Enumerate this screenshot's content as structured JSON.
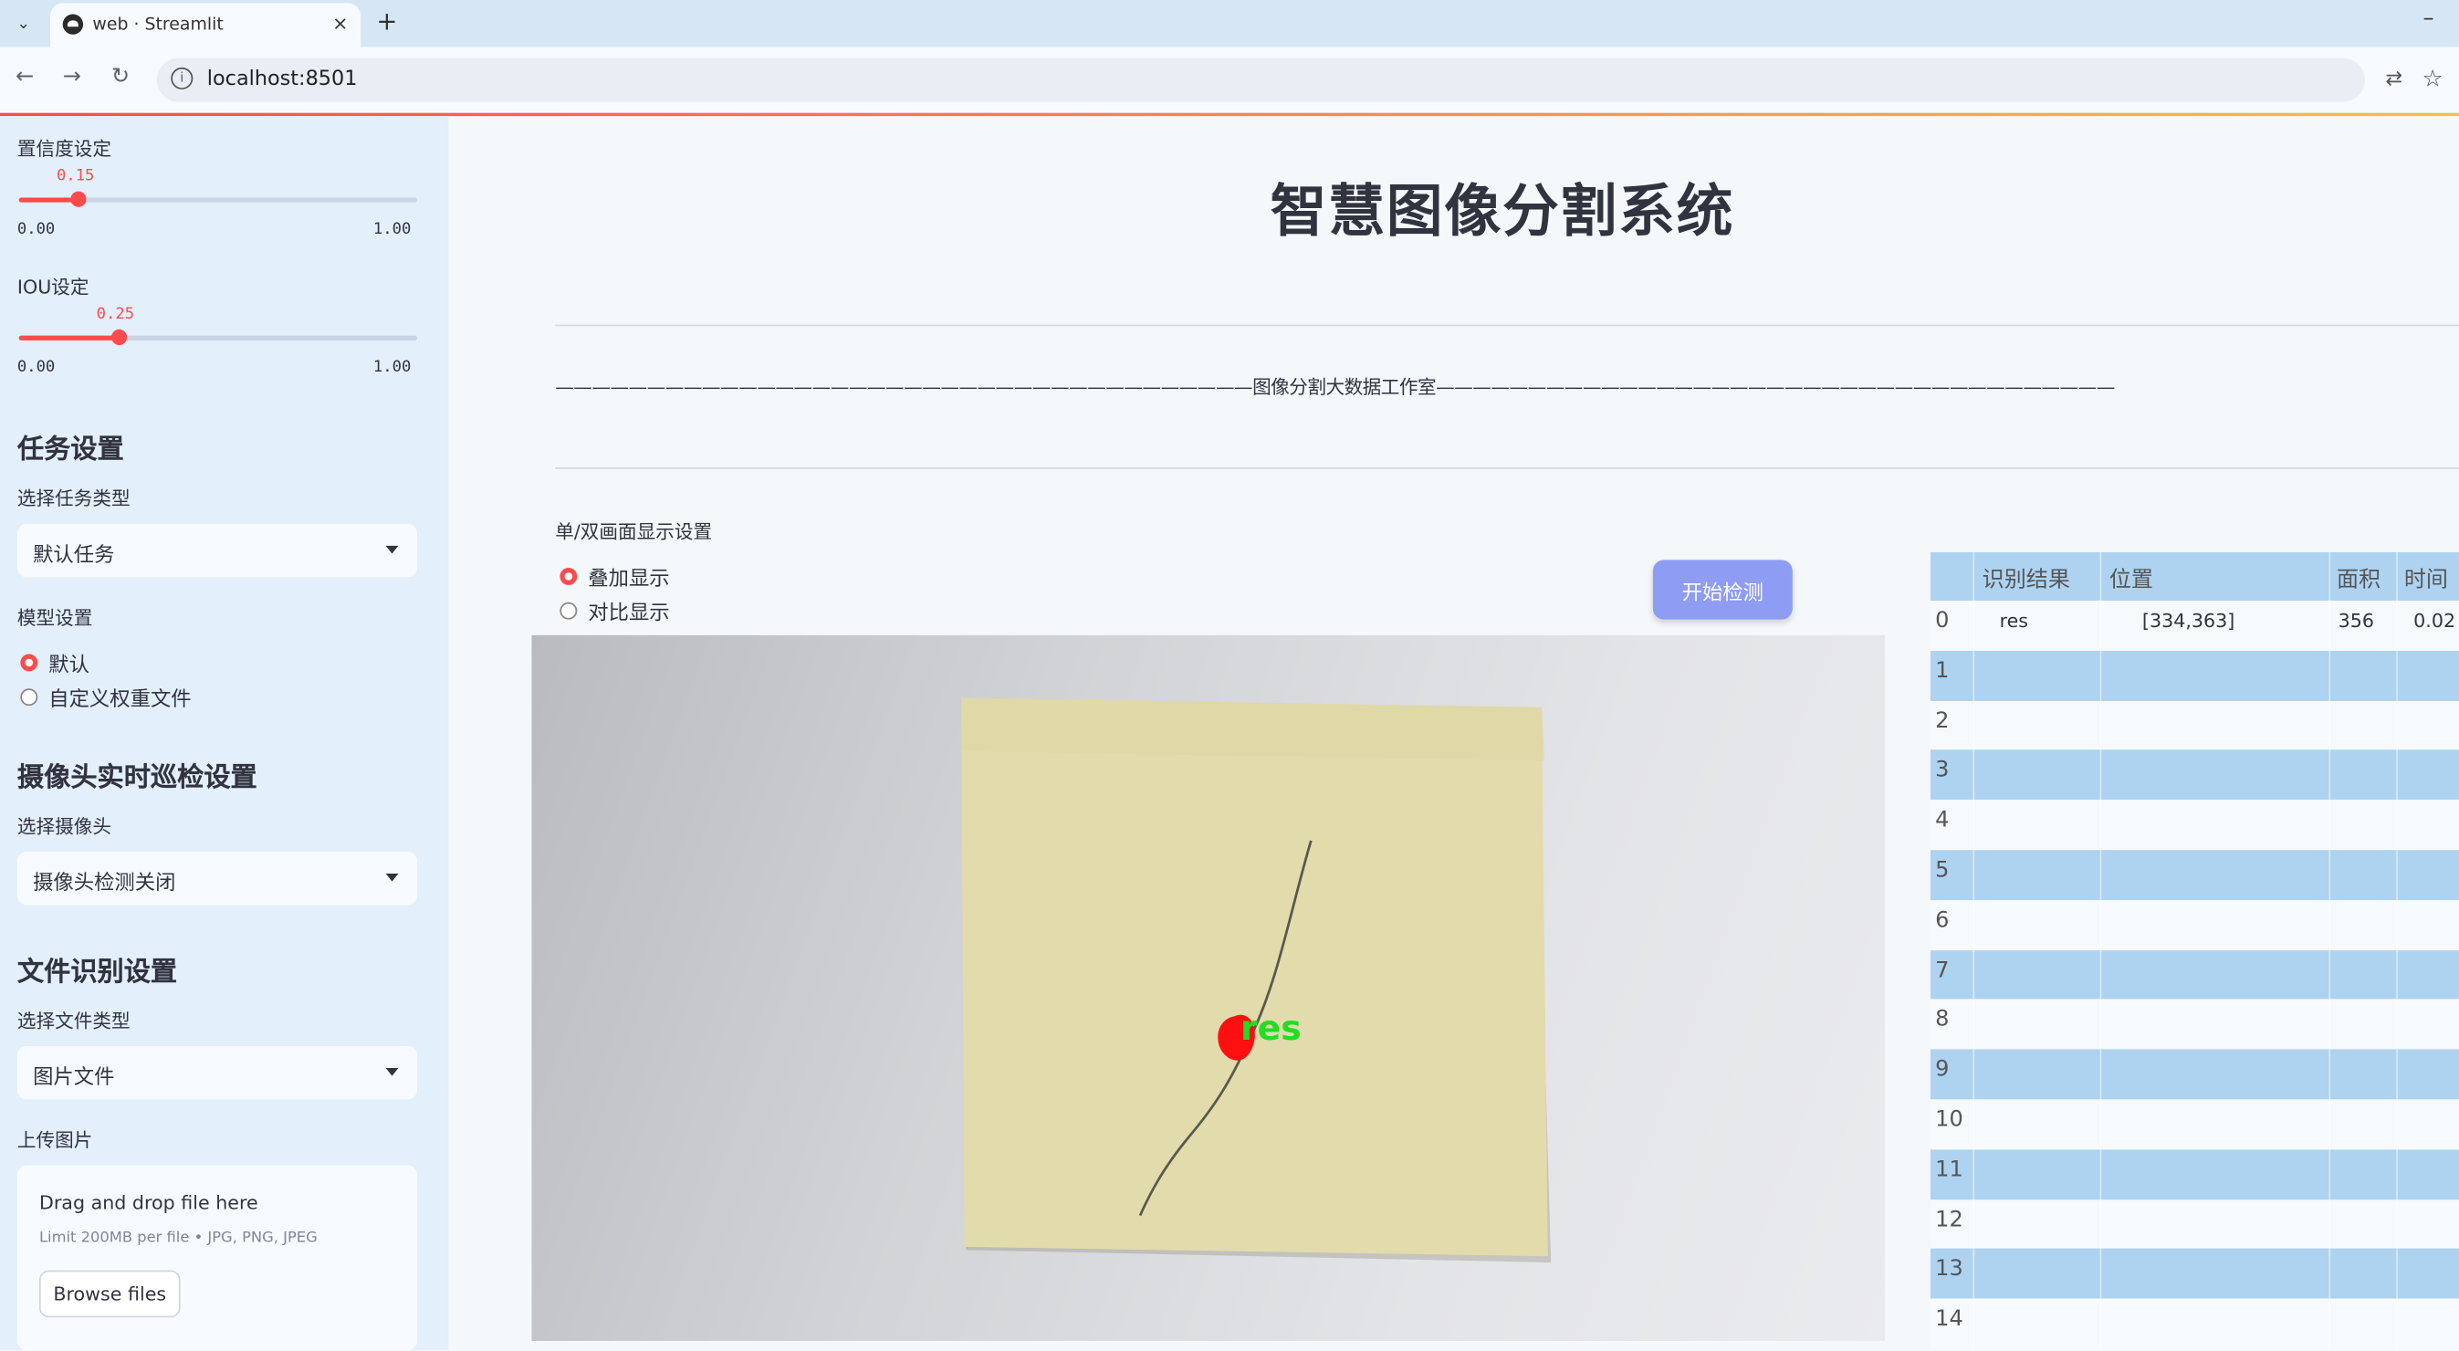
{
  "browser": {
    "tab_title": "web · Streamlit",
    "url": "localhost:8501",
    "new_tab": "+",
    "close": "×",
    "minimize": "–"
  },
  "sidebar": {
    "confidence": {
      "label": "置信度设定",
      "value": "0.15",
      "fraction": 0.15,
      "min": "0.00",
      "max": "1.00"
    },
    "iou": {
      "label": "IOU设定",
      "value": "0.25",
      "fraction": 0.25,
      "min": "0.00",
      "max": "1.00"
    },
    "task_section": "任务设置",
    "task_type_label": "选择任务类型",
    "task_type_value": "默认任务",
    "model_label": "模型设置",
    "model_options": [
      "默认",
      "自定义权重文件"
    ],
    "camera_section": "摄像头实时巡检设置",
    "camera_label": "选择摄像头",
    "camera_value": "摄像头检测关闭",
    "file_section": "文件识别设置",
    "file_type_label": "选择文件类型",
    "file_type_value": "图片文件",
    "upload_label": "上传图片",
    "upload_drop": "Drag and drop file here",
    "upload_limit": "Limit 200MB per file • JPG, PNG, JPEG",
    "upload_button": "Browse files"
  },
  "main": {
    "title": "智慧图像分割系统",
    "subtitle": "——————————————————————————————————————图像分割大数据工作室—————————————————————————————————————",
    "display_label": "单/双画面显示设置",
    "display_options": [
      "叠加显示",
      "对比显示"
    ],
    "start_button": "开始检测",
    "detection_label": "res"
  },
  "table": {
    "columns": [
      "识别结果",
      "位置",
      "面积",
      "时间"
    ],
    "rows": [
      {
        "index": "0",
        "result": "res",
        "position": "[334,363]",
        "area": "356",
        "time": "0.02"
      },
      {
        "index": "1"
      },
      {
        "index": "2"
      },
      {
        "index": "3"
      },
      {
        "index": "4"
      },
      {
        "index": "5"
      },
      {
        "index": "6"
      },
      {
        "index": "7"
      },
      {
        "index": "8"
      },
      {
        "index": "9"
      },
      {
        "index": "10"
      },
      {
        "index": "11"
      },
      {
        "index": "12"
      },
      {
        "index": "13"
      },
      {
        "index": "14"
      }
    ]
  },
  "colors": {
    "accent": "#ff4b4b",
    "button": "#8e9cf3",
    "table_header": "#aed3f1",
    "detection_text": "#22dd22"
  }
}
